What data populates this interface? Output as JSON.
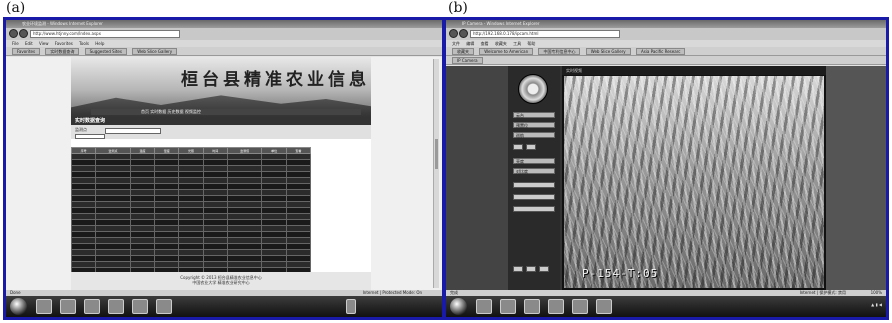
{
  "labels": {
    "a": "(a)",
    "b": "(b)"
  },
  "shot_a": {
    "window_title": "农业环境监测 - Windows Internet Explorer",
    "url": "http://www.htjnny.com/Index.aspx",
    "menu": [
      "File",
      "Edit",
      "View",
      "Favorites",
      "Tools",
      "Help"
    ],
    "favorites": [
      "Favorites",
      "实时数据查询",
      "Suggested Sites",
      "Web Slice Gallery"
    ],
    "banner_title": "桓台县精准农业信息中心",
    "nav_text": "首页  实时数据  历史数据  视频监控",
    "section_title": "实时数据查询",
    "filter_label": "监测点",
    "table_headers": [
      "序号",
      "监测点",
      "温度",
      "湿度",
      "光照",
      "时间",
      "监测值",
      "单位",
      "查看"
    ],
    "footer_line1": "Copyright © 2013 桓台县精准农业信息中心",
    "footer_line2": "中国农业大学 精准农业研究中心",
    "status_left": "Done",
    "status_right": "Internet | Protected Mode: On"
  },
  "shot_b": {
    "window_title": "IP Camera - Windows Internet Explorer",
    "url": "http://192.168.0.178/ipcam.html",
    "menu": [
      "文件",
      "编辑",
      "查看",
      "收藏夹",
      "工具",
      "帮助"
    ],
    "favorites": [
      "收藏夹",
      "Welcome to American",
      "中国专利信息中心",
      "Web Slice Gallery",
      "Asia Pacific Researc"
    ],
    "tab": "IP Camera",
    "video_header": "实时视频",
    "overlay_text": "P-154-T:05",
    "controls": [
      "云台",
      "预置位",
      "巡航",
      "亮度",
      "对比度"
    ],
    "status_left": "完成",
    "status_right": "Internet | 保护模式: 禁用",
    "zoom": "100%"
  }
}
